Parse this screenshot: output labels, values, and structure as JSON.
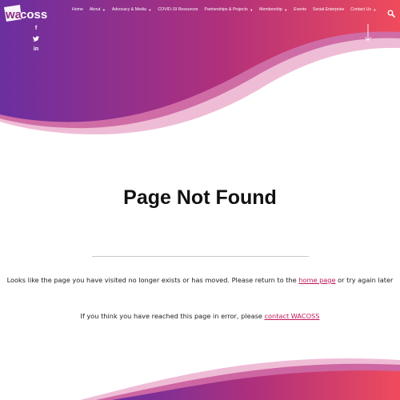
{
  "colors": {
    "gradient_start": "#6b2fa0",
    "gradient_mid": "#b0307c",
    "gradient_end": "#ef4b5c",
    "link": "#c2185b"
  },
  "brand": {
    "logo_text": "wacoss"
  },
  "nav": {
    "items": [
      {
        "label": "Home",
        "has_dropdown": false
      },
      {
        "label": "About",
        "has_dropdown": true
      },
      {
        "label": "Advocacy & Media",
        "has_dropdown": true
      },
      {
        "label": "COVID-19 Resources",
        "has_dropdown": false
      },
      {
        "label": "Partnerships & Projects",
        "has_dropdown": true
      },
      {
        "label": "Membership",
        "has_dropdown": true
      },
      {
        "label": "Events",
        "has_dropdown": false
      },
      {
        "label": "Social Enterprise",
        "has_dropdown": false
      },
      {
        "label": "Contact Us",
        "has_dropdown": true
      }
    ],
    "search_icon": "search-icon"
  },
  "social": {
    "facebook": "f",
    "twitter": "twitter-icon",
    "linkedin": "in"
  },
  "hero": {
    "scroll_icon": "arrow-down-icon"
  },
  "main": {
    "title": "Page Not Found",
    "message1": {
      "before": "Looks like the page you have visited no longer exists or has moved. Please return to the ",
      "link": "home page",
      "after": " or try again later"
    },
    "message2": {
      "before": "If you think you have reached this page in error, please ",
      "link": "contact WACOSS",
      "after": ""
    }
  }
}
